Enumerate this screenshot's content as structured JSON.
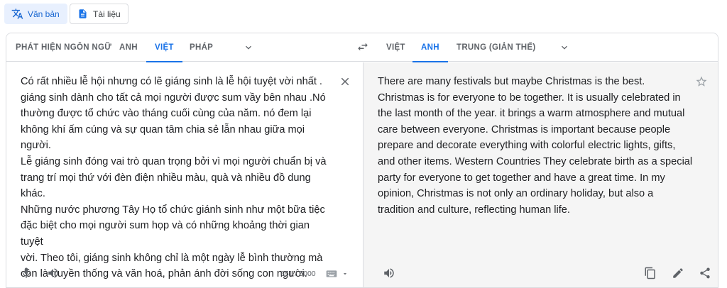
{
  "modes": {
    "text_label": "Văn bản",
    "docs_label": "Tài liệu"
  },
  "source_langs": {
    "tabs": [
      "PHÁT HIỆN NGÔN NGỮ",
      "ANH",
      "VIỆT",
      "PHÁP"
    ],
    "active": "VIỆT"
  },
  "target_langs": {
    "tabs": [
      "VIỆT",
      "ANH",
      "TRUNG (GIẢN THỂ)"
    ],
    "active": "ANH"
  },
  "source": {
    "text": "Có rất nhiều lễ hội nhưng có lẽ giáng sinh là lễ hội tuyệt vời nhất .\ngiáng sinh dành cho tất cả mọi người được sum vầy bên nhau .Nó\nthường được tổ chức vào tháng cuối cùng của năm. nó đem lại\nkhông khí ấm cúng và sự quan tâm chia sẻ lẫn nhau giữa mọi người.\nLễ giáng sinh đóng vai trò quan trọng bởi vì mọi người chuẩn bị và\ntrang trí mọi thứ với đèn điện nhiều màu, quà và nhiều đồ dung khác.\nNhững nước phương Tây Họ tổ chức giánh sinh như một bữa tiệc\nđặc biệt cho mọi người sum họp và có những khoảng thời gian tuyệt\nvời. Theo tôi, giáng sinh không chỉ là một ngày lễ bình thường mà\ncòn là truyền thống và văn hoá, phản ánh đời sống con người.",
    "char_count": "651 / 5000"
  },
  "target": {
    "text": "There are many festivals but maybe Christmas is the best.\nChristmas is for everyone to be together. It is usually celebrated in\nthe last month of the year. it brings a warm atmosphere and mutual\ncare between everyone. Christmas is important because people\nprepare and decorate everything with colorful electric lights, gifts,\nand other items. Western Countries They celebrate birth as a special\nparty for everyone to get together and have a great time. In my\nopinion, Christmas is not only an ordinary holiday, but also a\ntradition and culture, reflecting human life."
  },
  "icons": {
    "translate": "translate-icon",
    "document": "document-icon",
    "swap": "swap-icon",
    "chevron": "chevron-down-icon",
    "close": "close-icon",
    "star": "star-icon",
    "mic": "microphone-icon",
    "speaker": "speaker-icon",
    "keyboard": "keyboard-icon",
    "copy": "copy-icon",
    "edit": "pencil-icon",
    "share": "share-icon"
  },
  "colors": {
    "accent": "#1a73e8",
    "active_mode_bg": "#e8f0fe",
    "target_bg": "#f5f5f5"
  }
}
